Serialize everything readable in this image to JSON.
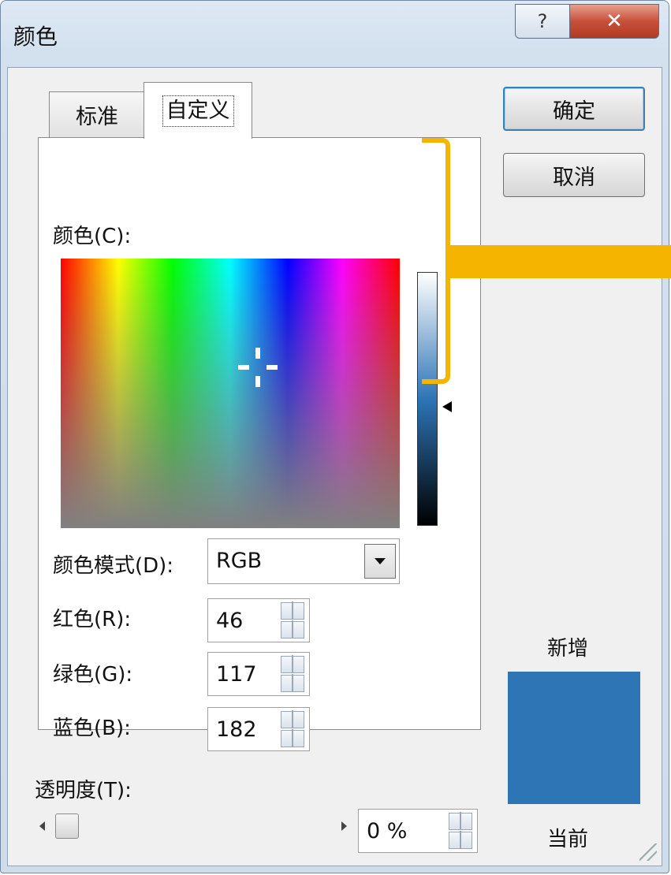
{
  "window": {
    "title": "颜色",
    "help_glyph": "?",
    "close_glyph": "✕"
  },
  "tabs": [
    {
      "label": "标准"
    },
    {
      "label": "自定义"
    }
  ],
  "custom": {
    "color_label": "颜色(C):",
    "color_mode_label": "颜色模式(D):",
    "color_mode_value": "RGB",
    "red_label": "红色(R):",
    "red_value": "46",
    "green_label": "绿色(G):",
    "green_value": "117",
    "blue_label": "蓝色(B):",
    "blue_value": "182"
  },
  "transparency": {
    "label": "透明度(T):",
    "value": "0 %",
    "slider_fraction": 0
  },
  "buttons": {
    "ok": "确定",
    "cancel": "取消"
  },
  "preview": {
    "new_label": "新增",
    "current_label": "当前",
    "color": "#2E75B6"
  },
  "colors": {
    "annotation": "#F4B400",
    "close_button": "#C7503A"
  }
}
